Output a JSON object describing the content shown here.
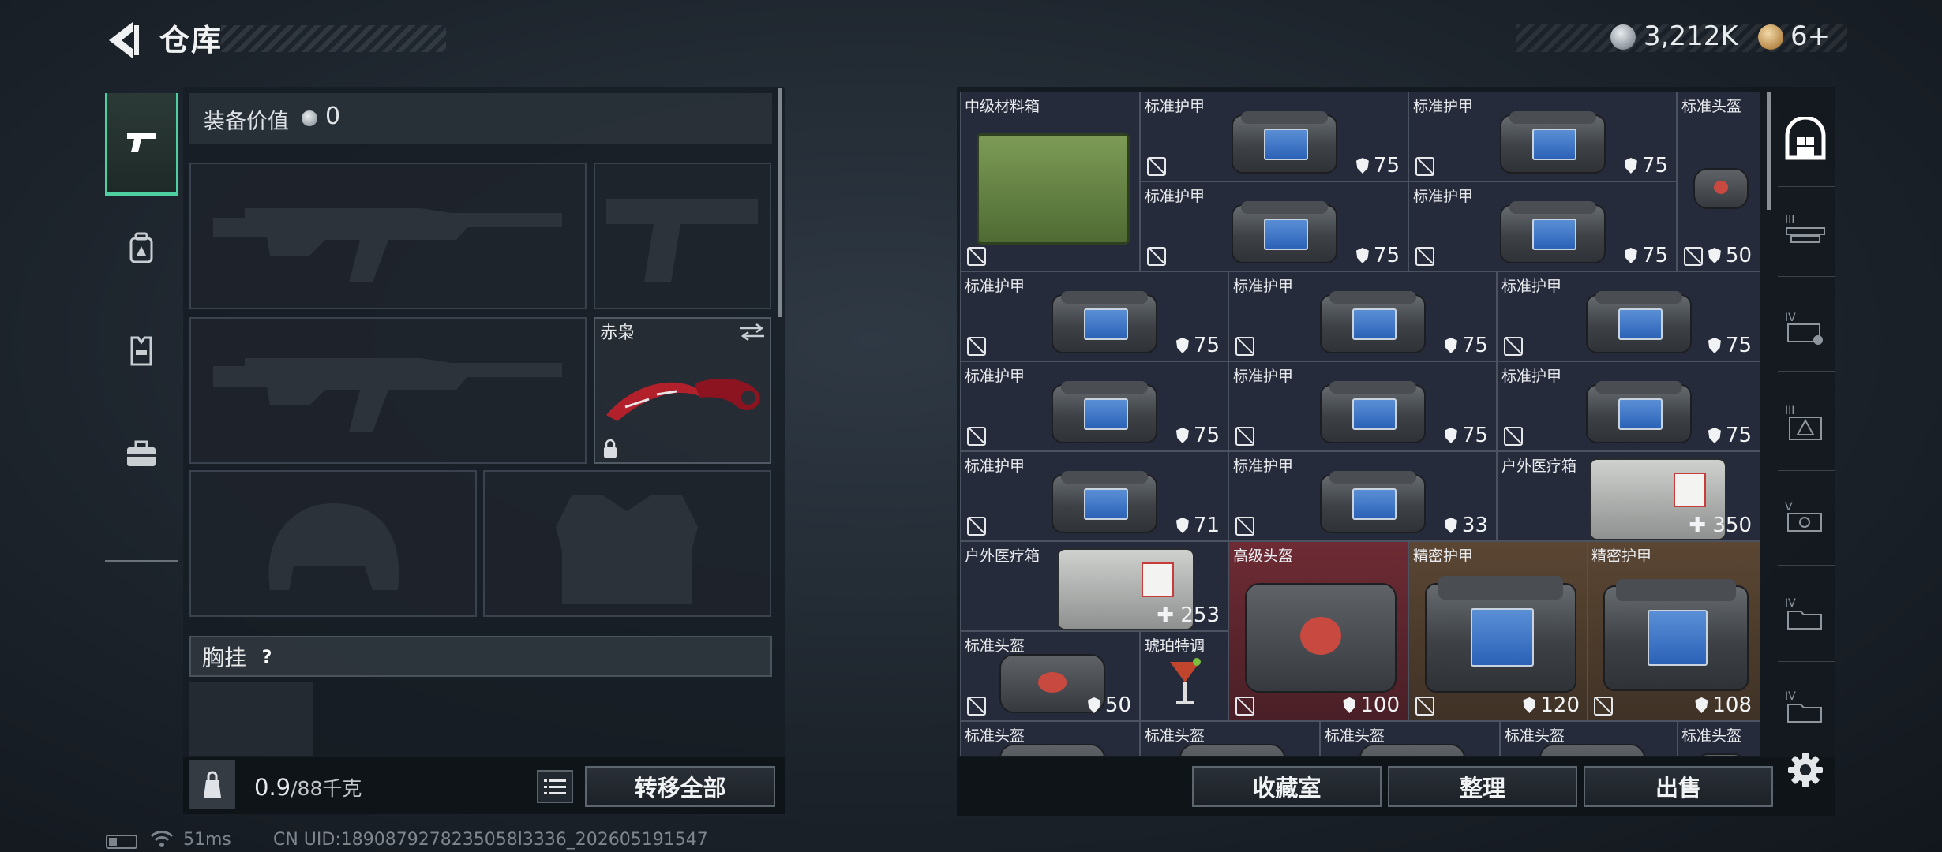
{
  "header": {
    "title": "仓库"
  },
  "currency": {
    "silver": "3,212K",
    "gold": "6+"
  },
  "equipment": {
    "value_label": "装备价值",
    "value": "0",
    "knife_name": "赤枭",
    "chest_label": "胸挂",
    "chest_help": "?"
  },
  "bag": {
    "weight_current": "0.9",
    "weight_max": "/88千克"
  },
  "buttons": {
    "transfer_all": "转移全部",
    "collection": "收藏室",
    "organize": "整理",
    "sell": "出售"
  },
  "inventory": [
    {
      "name": "中级材料箱"
    },
    {
      "name": "标准护甲",
      "value": "75"
    },
    {
      "name": "标准护甲",
      "value": "75"
    },
    {
      "name": "标准头盔",
      "value": "50"
    },
    {
      "name": "标准护甲",
      "value": "75"
    },
    {
      "name": "标准护甲",
      "value": "75"
    },
    {
      "name": "标准护甲",
      "value": "75"
    },
    {
      "name": "标准护甲",
      "value": "75"
    },
    {
      "name": "标准护甲",
      "value": "75"
    },
    {
      "name": "标准护甲",
      "value": "75"
    },
    {
      "name": "标准护甲",
      "value": "75"
    },
    {
      "name": "标准护甲",
      "value": "75"
    },
    {
      "name": "标准护甲",
      "value": "71"
    },
    {
      "name": "标准护甲",
      "value": "33"
    },
    {
      "name": "户外医疗箱",
      "value": "350"
    },
    {
      "name": "户外医疗箱",
      "value": "253"
    },
    {
      "name": "高级头盔",
      "value": "100"
    },
    {
      "name": "精密护甲",
      "value": "120"
    },
    {
      "name": "精密护甲",
      "value": "108"
    },
    {
      "name": "标准头盔",
      "value": "50"
    },
    {
      "name": "琥珀特调"
    },
    {
      "name": "标准头盔"
    },
    {
      "name": "标准头盔"
    },
    {
      "name": "标准头盔"
    },
    {
      "name": "标准头盔"
    },
    {
      "name": "标准头盔"
    }
  ],
  "status": {
    "ping": "51ms",
    "uid": "CN UID:1890879278235058l3336_202605191547"
  },
  "colors": {
    "accent": "#4fd0a1",
    "rare_red": "#6e2b34",
    "rare_gold": "#5b4633"
  }
}
